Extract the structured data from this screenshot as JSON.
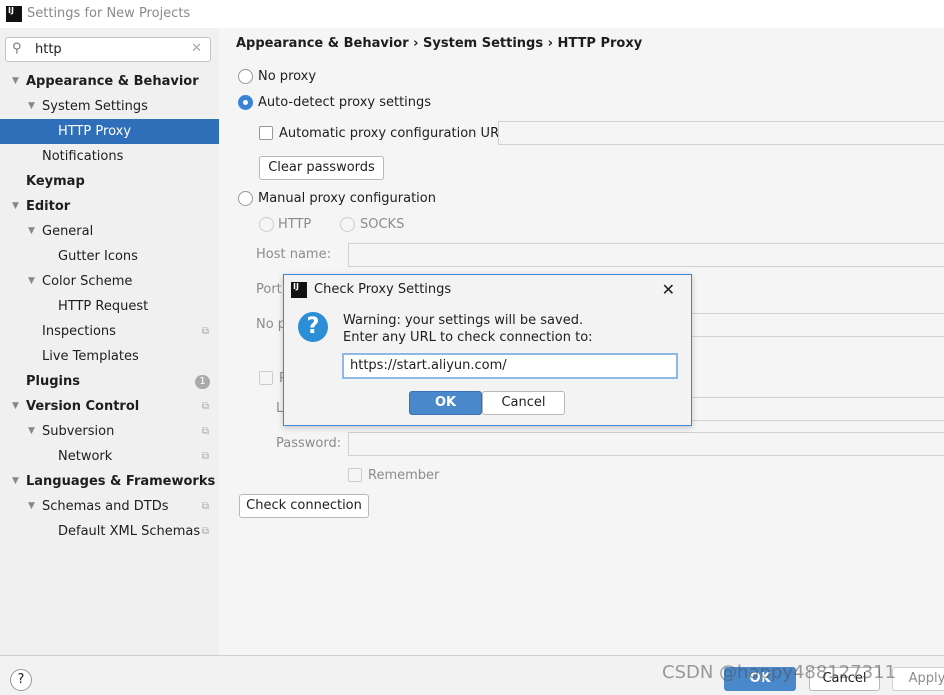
{
  "window": {
    "title": "Settings for New Projects",
    "icon": "intellij-icon"
  },
  "search": {
    "value": "http",
    "icon": "search-icon",
    "clear_icon": "close-icon"
  },
  "tree": [
    {
      "label": "Appearance & Behavior",
      "level": 0,
      "bold": true,
      "expanded": true
    },
    {
      "label": "System Settings",
      "level": 1,
      "expanded": true
    },
    {
      "label": "HTTP Proxy",
      "level": 2,
      "selected": true
    },
    {
      "label": "Notifications",
      "level": 1
    },
    {
      "label": "Keymap",
      "level": 0,
      "bold": true
    },
    {
      "label": "Editor",
      "level": 0,
      "bold": true,
      "expanded": true
    },
    {
      "label": "General",
      "level": 1,
      "expanded": true
    },
    {
      "label": "Gutter Icons",
      "level": 2
    },
    {
      "label": "Color Scheme",
      "level": 1,
      "expanded": true
    },
    {
      "label": "HTTP Request",
      "level": 2
    },
    {
      "label": "Inspections",
      "level": 1,
      "copy": true
    },
    {
      "label": "Live Templates",
      "level": 1
    },
    {
      "label": "Plugins",
      "level": 0,
      "bold": true,
      "badge": "1"
    },
    {
      "label": "Version Control",
      "level": 0,
      "bold": true,
      "expanded": true,
      "copy": true
    },
    {
      "label": "Subversion",
      "level": 1,
      "expanded": true,
      "copy": true
    },
    {
      "label": "Network",
      "level": 2,
      "copy": true
    },
    {
      "label": "Languages & Frameworks",
      "level": 0,
      "bold": true,
      "expanded": true
    },
    {
      "label": "Schemas and DTDs",
      "level": 1,
      "expanded": true,
      "copy": true
    },
    {
      "label": "Default XML Schemas",
      "level": 2,
      "copy": true
    }
  ],
  "breadcrumb": "Appearance & Behavior  ›  System Settings  ›  HTTP Proxy",
  "proxy": {
    "no_proxy": "No proxy",
    "auto_detect": "Auto-detect proxy settings",
    "auto_config_url": "Automatic proxy configuration URL:",
    "clear_passwords": "Clear passwords",
    "manual": "Manual proxy configuration",
    "http": "HTTP",
    "socks": "SOCKS",
    "host_name": "Host name:",
    "port": "Port",
    "no_proxy_for": "No p",
    "proxy_auth": "P",
    "login": "L",
    "password": "Password:",
    "remember": "Remember",
    "check_connection": "Check connection",
    "selected": "auto_detect"
  },
  "dialog": {
    "title": "Check Proxy Settings",
    "icon": "question-icon",
    "line1": "Warning: your settings will be saved.",
    "line2": "Enter any URL to check connection to:",
    "url": "https://start.aliyun.com/",
    "ok": "OK",
    "cancel": "Cancel"
  },
  "footer": {
    "help": "?",
    "ok": "OK",
    "cancel": "Cancel",
    "apply": "Apply"
  },
  "watermark": "CSDN @happy488127311",
  "colors": {
    "accent": "#2f6fba",
    "dialog_border": "#3c87d3",
    "ok_button": "#4a88cc"
  }
}
